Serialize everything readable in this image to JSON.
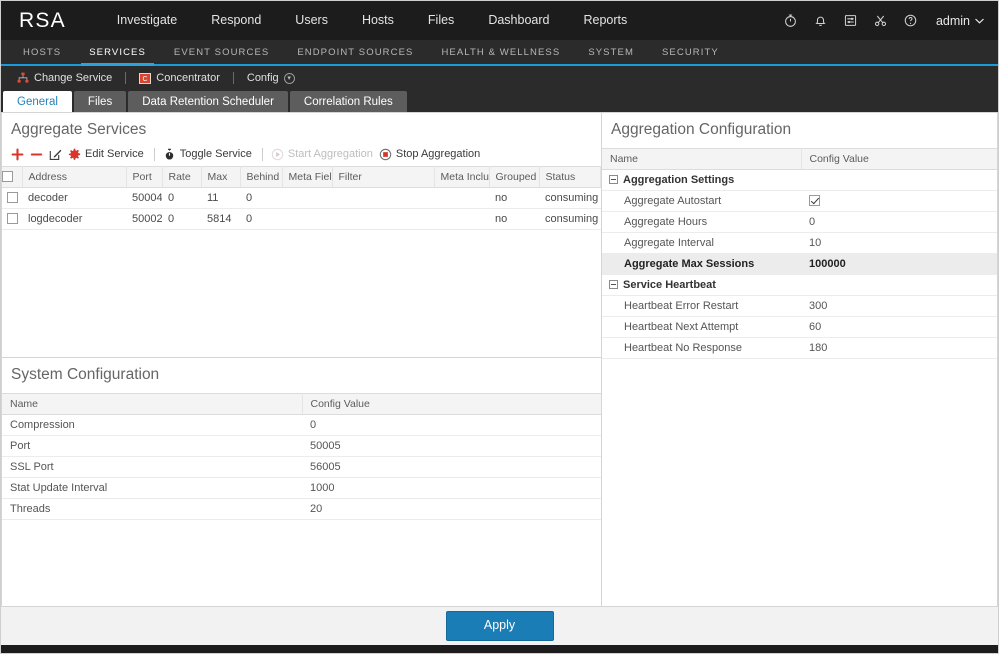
{
  "topbar": {
    "logo": "RSA",
    "nav": [
      {
        "label": "Investigate"
      },
      {
        "label": "Respond"
      },
      {
        "label": "Users"
      },
      {
        "label": "Hosts"
      },
      {
        "label": "Files"
      },
      {
        "label": "Dashboard"
      },
      {
        "label": "Reports"
      }
    ],
    "icons": [
      "stopwatch-icon",
      "bell-icon",
      "tasks-icon",
      "scissors-icon",
      "help-icon"
    ],
    "user": "admin"
  },
  "subnav": {
    "items": [
      {
        "label": "HOSTS",
        "active": false
      },
      {
        "label": "SERVICES",
        "active": true
      },
      {
        "label": "EVENT SOURCES",
        "active": false
      },
      {
        "label": "ENDPOINT SOURCES",
        "active": false
      },
      {
        "label": "HEALTH & WELLNESS",
        "active": false
      },
      {
        "label": "SYSTEM",
        "active": false
      },
      {
        "label": "SECURITY",
        "active": false
      }
    ],
    "accent": "#2aa4e0"
  },
  "servicebar": {
    "change_service": "Change Service",
    "service_name": "Concentrator",
    "config": "Config"
  },
  "tabs": [
    {
      "label": "General",
      "active": true
    },
    {
      "label": "Files",
      "active": false
    },
    {
      "label": "Data Retention Scheduler",
      "active": false
    },
    {
      "label": "Correlation Rules",
      "active": false
    }
  ],
  "aggregate_services": {
    "title": "Aggregate Services",
    "toolbar": [
      {
        "label": "",
        "icon": "plus-icon",
        "disabled": false
      },
      {
        "label": "",
        "icon": "minus-icon",
        "disabled": false
      },
      {
        "label": "",
        "icon": "pencil-icon",
        "disabled": false
      },
      {
        "label": "Edit Service",
        "icon": "gear-icon",
        "disabled": false
      },
      {
        "label": "Toggle Service",
        "icon": "toggle-icon",
        "disabled": false
      },
      {
        "label": "Start Aggregation",
        "icon": "play-icon",
        "disabled": true
      },
      {
        "label": "Stop Aggregation",
        "icon": "stop-icon",
        "disabled": false
      }
    ],
    "columns": [
      "Address",
      "Port",
      "Rate",
      "Max",
      "Behind",
      "Meta Fields",
      "Filter",
      "Meta Include",
      "Grouped",
      "Status"
    ],
    "rows": [
      {
        "checked": false,
        "address": "decoder",
        "port": "50004",
        "rate": "0",
        "max": "11",
        "behind": "0",
        "meta_fields": "",
        "filter": "",
        "meta_include": "",
        "grouped": "no",
        "status": "consuming"
      },
      {
        "checked": false,
        "address": "logdecoder",
        "port": "50002",
        "rate": "0",
        "max": "5814",
        "behind": "0",
        "meta_fields": "",
        "filter": "",
        "meta_include": "",
        "grouped": "no",
        "status": "consuming"
      }
    ]
  },
  "system_config": {
    "title": "System Configuration",
    "columns": [
      "Name",
      "Config Value"
    ],
    "rows": [
      {
        "name": "Compression",
        "value": "0"
      },
      {
        "name": "Port",
        "value": "50005"
      },
      {
        "name": "SSL Port",
        "value": "56005"
      },
      {
        "name": "Stat Update Interval",
        "value": "1000"
      },
      {
        "name": "Threads",
        "value": "20"
      }
    ]
  },
  "aggregation_config": {
    "title": "Aggregation Configuration",
    "columns": [
      "Name",
      "Config Value"
    ],
    "rows": [
      {
        "type": "group",
        "name": "Aggregation Settings",
        "value": ""
      },
      {
        "type": "item",
        "name": "Aggregate Autostart",
        "value": "",
        "checkbox": true,
        "checked": true
      },
      {
        "type": "item",
        "name": "Aggregate Hours",
        "value": "0"
      },
      {
        "type": "item",
        "name": "Aggregate Interval",
        "value": "10"
      },
      {
        "type": "item",
        "name": "Aggregate Max Sessions",
        "value": "100000",
        "selected": true
      },
      {
        "type": "group",
        "name": "Service Heartbeat",
        "value": ""
      },
      {
        "type": "item",
        "name": "Heartbeat Error Restart",
        "value": "300"
      },
      {
        "type": "item",
        "name": "Heartbeat Next Attempt",
        "value": "60"
      },
      {
        "type": "item",
        "name": "Heartbeat No Response",
        "value": "180"
      }
    ]
  },
  "footer": {
    "apply": "Apply",
    "apply_color": "#1a7db5"
  }
}
